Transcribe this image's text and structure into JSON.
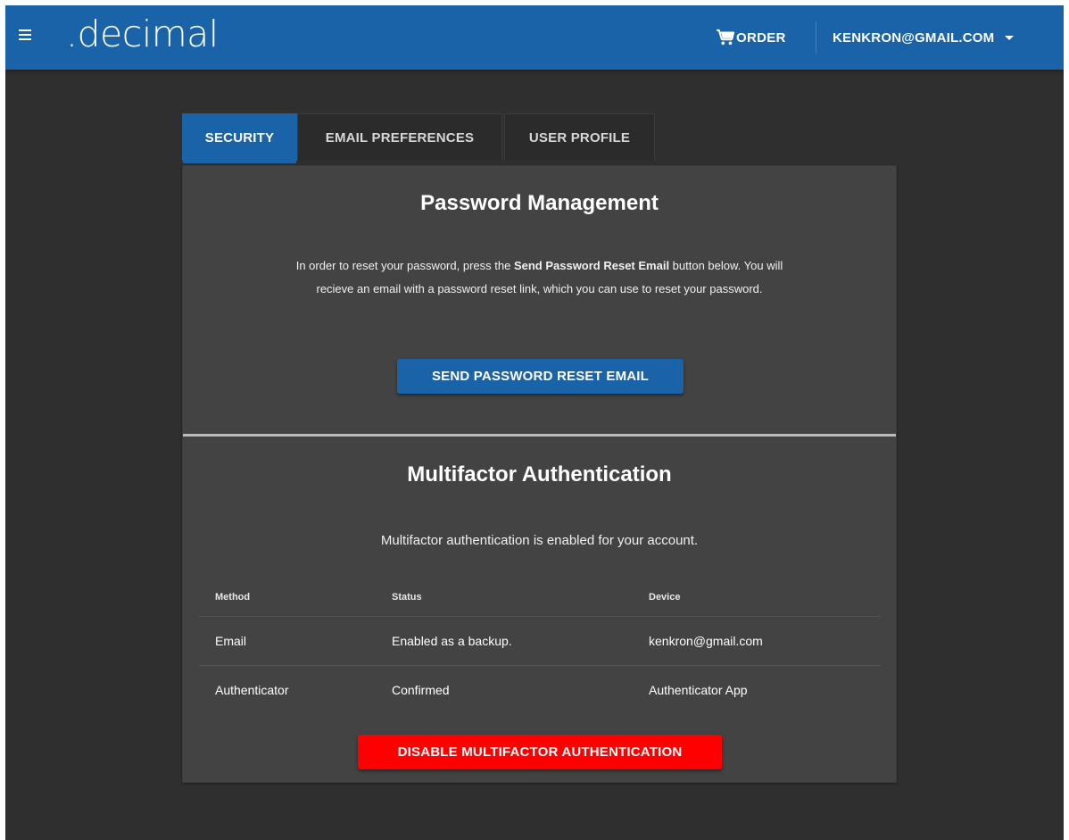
{
  "header": {
    "logo": ".decimal",
    "order_label": "ORDER",
    "account_label": "KENKRON@GMAIL.COM"
  },
  "icons": {
    "menu": "menu-icon",
    "cart": "cart-icon",
    "dropdown": "caret-down-icon"
  },
  "colors": {
    "brand_blue": "#1a63a8",
    "background": "#2f2f2f",
    "card": "#434343",
    "danger": "#ff0000"
  },
  "tabs": [
    {
      "label": "SECURITY",
      "active": true
    },
    {
      "label": "EMAIL PREFERENCES",
      "active": false
    },
    {
      "label": "USER PROFILE",
      "active": false
    }
  ],
  "password": {
    "title": "Password Management",
    "text_before": "In order to reset your password, press the ",
    "text_bold": "Send Password Reset Email",
    "text_after_line1": " button below. You will",
    "text_line2": "recieve an email with a password reset link, which you can use to reset your password.",
    "button_label": "SEND PASSWORD RESET EMAIL"
  },
  "mfa": {
    "title": "Multifactor Authentication",
    "status_text": "Multifactor authentication is enabled for your account.",
    "columns": [
      "Method",
      "Status",
      "Device"
    ],
    "rows": [
      [
        "Email",
        "Enabled as a backup.",
        "kenkron@gmail.com"
      ],
      [
        "Authenticator",
        "Confirmed",
        "Authenticator App"
      ]
    ],
    "disable_button_label": "DISABLE MULTIFACTOR AUTHENTICATION"
  }
}
